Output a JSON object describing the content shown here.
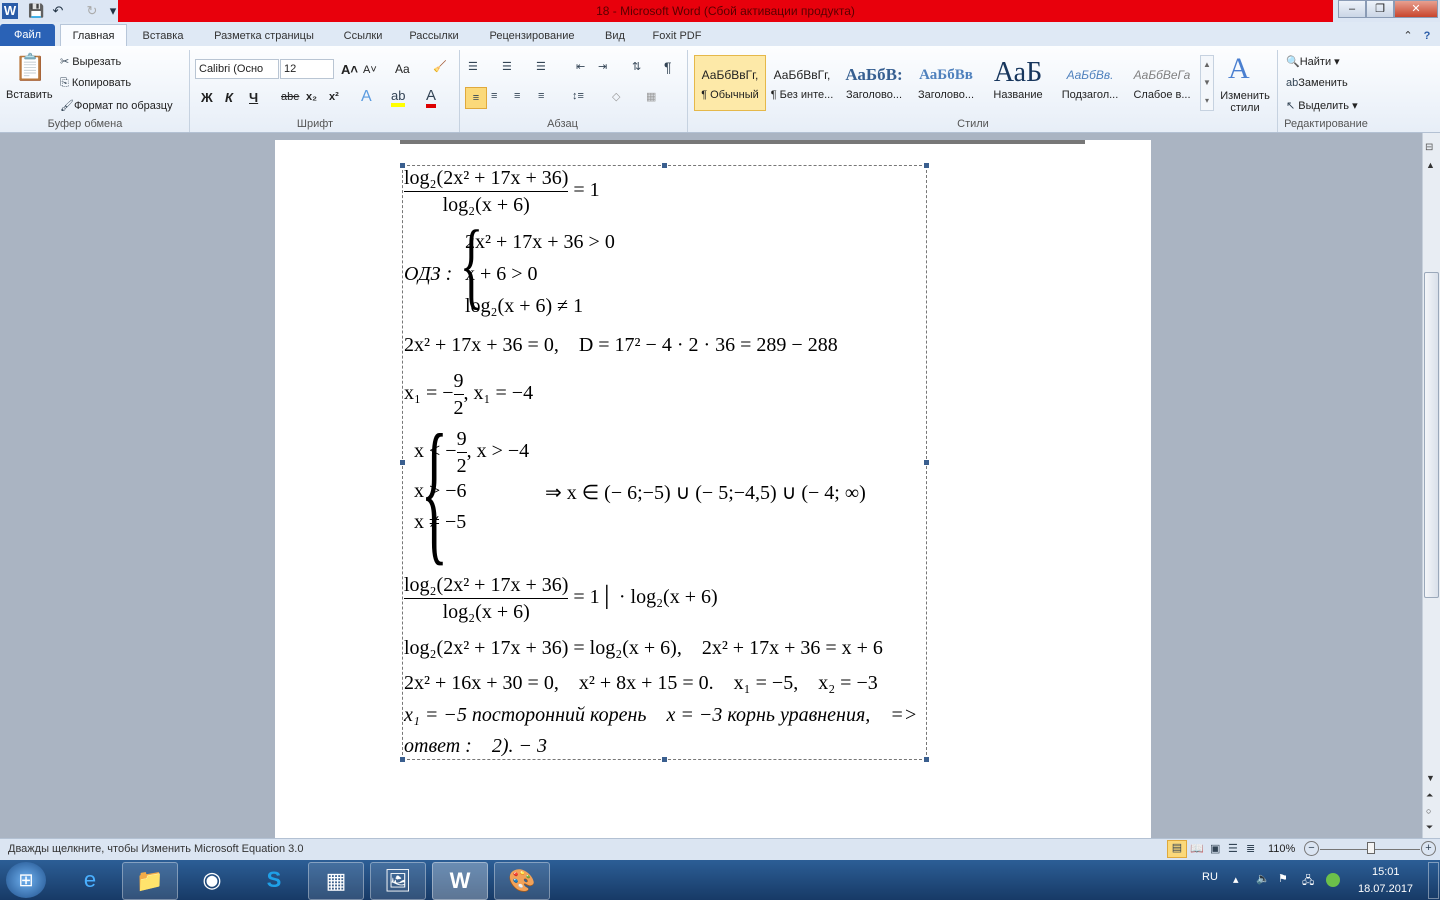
{
  "window": {
    "title": "18  -  Microsoft Word (Сбой активации продукта)"
  },
  "tabs": [
    "Файл",
    "Главная",
    "Вставка",
    "Разметка страницы",
    "Ссылки",
    "Рассылки",
    "Рецензирование",
    "Вид",
    "Foxit PDF"
  ],
  "clipboard": {
    "paste": "Вставить",
    "cut": "Вырезать",
    "copy": "Копировать",
    "format_painter": "Формат по образцу",
    "label": "Буфер обмена"
  },
  "font": {
    "name": "Calibri (Осно",
    "size": "12",
    "label": "Шрифт",
    "bold": "Ж",
    "italic": "К",
    "underline": "Ч",
    "strike": "abe",
    "sub": "x₂",
    "sup": "x²",
    "grow": "A˄",
    "shrink": "A˅",
    "case": "Aa"
  },
  "paragraph": {
    "label": "Абзац"
  },
  "styles": {
    "label": "Стили",
    "items": [
      {
        "sample": "АаБбВвГг,",
        "name": "¶ Обычный"
      },
      {
        "sample": "АаБбВвГг,",
        "name": "¶ Без инте..."
      },
      {
        "sample": "АаБбВ:",
        "name": "Заголово..."
      },
      {
        "sample": "АаБбВв",
        "name": "Заголово..."
      },
      {
        "sample": "АаБ",
        "name": "Название"
      },
      {
        "sample": "АаБбВв.",
        "name": "Подзагол..."
      },
      {
        "sample": "АаБбВеГа",
        "name": "Слабое в..."
      }
    ],
    "change": "Изменить",
    "change2": "стили"
  },
  "editing": {
    "label": "Редактирование",
    "find": "Найти",
    "replace": "Заменить",
    "select": "Выделить"
  },
  "math": {
    "l1": {
      "num": "log₂(2x² + 17x + 36)",
      "den": "log₂(x + 6)",
      "rhs": " = 1"
    },
    "odz": {
      "label": "ОДЗ : ",
      "a": "2x² + 17x + 36 > 0",
      "b": "x + 6 > 0",
      "c": "log₂(x + 6) ≠ 1"
    },
    "l3": "2x² + 17x + 36 = 0,    D = 17² − 4 · 2 · 36 = 289 − 288",
    "l4": {
      "a": "x₁ = −",
      "num": "9",
      "den": "2",
      "b": ", x₁ = −4"
    },
    "sys": {
      "a1": "x < −",
      "num": "9",
      "den": "2",
      "a2": ", x > −4",
      "b": "x > −6",
      "c": "x ≠ −5",
      "result": "⇒ x ∈ (− 6;−5) ∪ (− 5;−4,5) ∪ (− 4; ∞)"
    },
    "l6": {
      "num": "log₂(2x² + 17x + 36)",
      "den": "log₂(x + 6)",
      "rhs": " = 1│ · log₂(x + 6)"
    },
    "l7": "log₂(2x² + 17x + 36) = log₂(x + 6),    2x² + 17x + 36 = x + 6",
    "l8": "2x² + 16x + 30 = 0,    x² + 8x + 15 = 0.    x₁ = −5,    x₂ = −3",
    "l9": "x₁ = −5 посторонний корень    x = −3 корнь уравнения,    =>",
    "l10": "ответ :    2). − 3"
  },
  "status": {
    "text": "Дважды щелкните, чтобы Изменить Microsoft Equation 3.0",
    "zoom": "110%"
  },
  "tray": {
    "lang": "RU",
    "time": "15:01",
    "date": "18.07.2017"
  }
}
